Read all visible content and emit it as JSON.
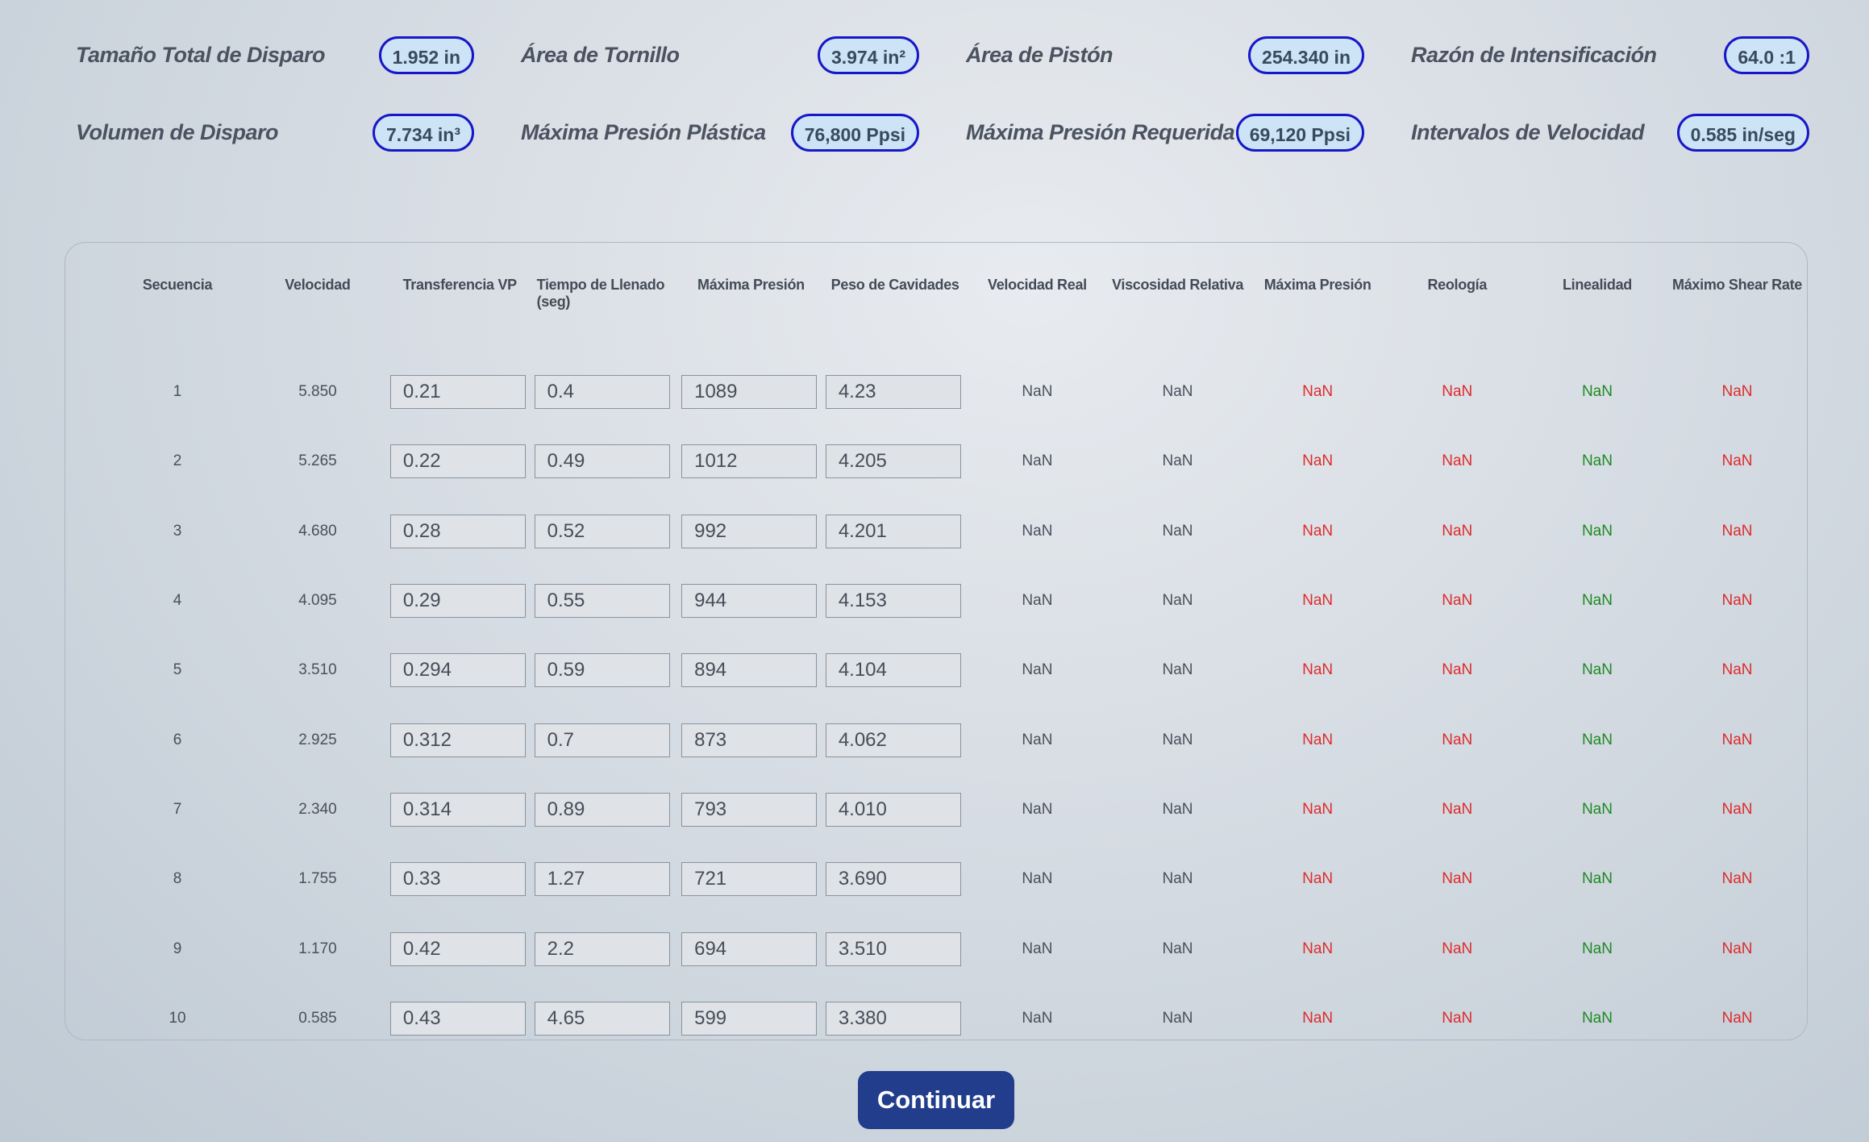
{
  "summary": [
    {
      "label": "Tamaño Total de Disparo",
      "value": "1.952 in"
    },
    {
      "label": "Área de Tornillo",
      "value": "3.974 in²"
    },
    {
      "label": "Área de Pistón",
      "value": "254.340 in"
    },
    {
      "label": "Razón de Intensificación",
      "value": "64.0 :1"
    },
    {
      "label": "Volumen de Disparo",
      "value": "7.734 in³"
    },
    {
      "label": "Máxima Presión Plástica",
      "value": "76,800 Ppsi"
    },
    {
      "label": "Máxima Presión Requerida",
      "value": "69,120 Ppsi"
    },
    {
      "label": "Intervalos de Velocidad",
      "value": "0.585 in/seg"
    }
  ],
  "table": {
    "headers": [
      "Secuencia",
      "Velocidad",
      "Transferencia VP",
      "Tiempo de Llenado (seg)",
      "Máxima Presión",
      "Peso de Cavidades",
      "Velocidad Real",
      "Viscosidad Relativa",
      "Máxima Presión",
      "Reología",
      "Linealidad",
      "Máximo Shear Rate"
    ],
    "rows": [
      {
        "seq": "1",
        "vel": "5.850",
        "vp": "0.21",
        "fill": "0.4",
        "pres": "1089",
        "peso": "4.23",
        "vr": "NaN",
        "visc": "NaN",
        "maxp": "NaN",
        "reo": "NaN",
        "lin": "NaN",
        "shear": "NaN"
      },
      {
        "seq": "2",
        "vel": "5.265",
        "vp": "0.22",
        "fill": "0.49",
        "pres": "1012",
        "peso": "4.205",
        "vr": "NaN",
        "visc": "NaN",
        "maxp": "NaN",
        "reo": "NaN",
        "lin": "NaN",
        "shear": "NaN"
      },
      {
        "seq": "3",
        "vel": "4.680",
        "vp": "0.28",
        "fill": "0.52",
        "pres": "992",
        "peso": "4.201",
        "vr": "NaN",
        "visc": "NaN",
        "maxp": "NaN",
        "reo": "NaN",
        "lin": "NaN",
        "shear": "NaN"
      },
      {
        "seq": "4",
        "vel": "4.095",
        "vp": "0.29",
        "fill": "0.55",
        "pres": "944",
        "peso": "4.153",
        "vr": "NaN",
        "visc": "NaN",
        "maxp": "NaN",
        "reo": "NaN",
        "lin": "NaN",
        "shear": "NaN"
      },
      {
        "seq": "5",
        "vel": "3.510",
        "vp": "0.294",
        "fill": "0.59",
        "pres": "894",
        "peso": "4.104",
        "vr": "NaN",
        "visc": "NaN",
        "maxp": "NaN",
        "reo": "NaN",
        "lin": "NaN",
        "shear": "NaN"
      },
      {
        "seq": "6",
        "vel": "2.925",
        "vp": "0.312",
        "fill": "0.7",
        "pres": "873",
        "peso": "4.062",
        "vr": "NaN",
        "visc": "NaN",
        "maxp": "NaN",
        "reo": "NaN",
        "lin": "NaN",
        "shear": "NaN"
      },
      {
        "seq": "7",
        "vel": "2.340",
        "vp": "0.314",
        "fill": "0.89",
        "pres": "793",
        "peso": "4.010",
        "vr": "NaN",
        "visc": "NaN",
        "maxp": "NaN",
        "reo": "NaN",
        "lin": "NaN",
        "shear": "NaN"
      },
      {
        "seq": "8",
        "vel": "1.755",
        "vp": "0.33",
        "fill": "1.27",
        "pres": "721",
        "peso": "3.690",
        "vr": "NaN",
        "visc": "NaN",
        "maxp": "NaN",
        "reo": "NaN",
        "lin": "NaN",
        "shear": "NaN"
      },
      {
        "seq": "9",
        "vel": "1.170",
        "vp": "0.42",
        "fill": "2.2",
        "pres": "694",
        "peso": "3.510",
        "vr": "NaN",
        "visc": "NaN",
        "maxp": "NaN",
        "reo": "NaN",
        "lin": "NaN",
        "shear": "NaN"
      },
      {
        "seq": "10",
        "vel": "0.585",
        "vp": "0.43",
        "fill": "4.65",
        "pres": "599",
        "peso": "3.380",
        "vr": "NaN",
        "visc": "NaN",
        "maxp": "NaN",
        "reo": "NaN",
        "lin": "NaN",
        "shear": "NaN"
      }
    ]
  },
  "colors": {
    "accent": "#213d8c",
    "pill_border": "#1717c8",
    "pill_fill": "#cde3f6",
    "bad": "#dd2b2b",
    "good": "#1d8a22"
  },
  "continue_label": "Continuar"
}
